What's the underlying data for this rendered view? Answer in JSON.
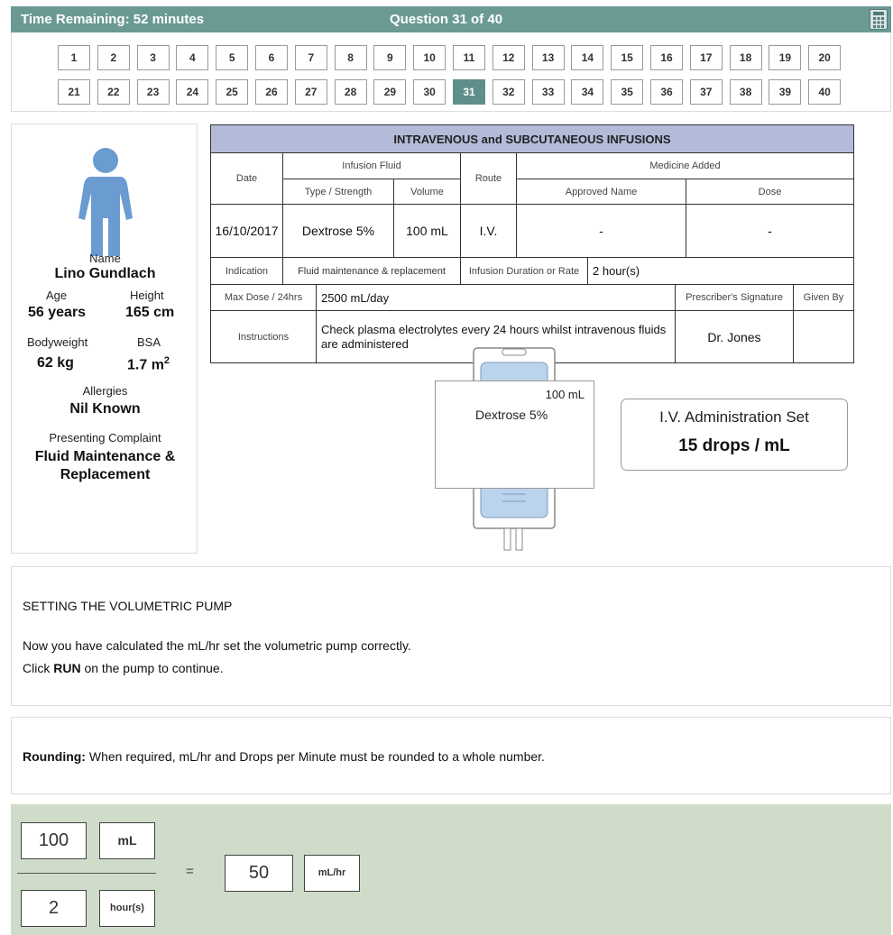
{
  "header": {
    "time_remaining": "Time Remaining: 52 minutes",
    "question_counter": "Question 31 of 40",
    "calculator_icon": "calculator-icon"
  },
  "question_nav": {
    "row1": [
      "1",
      "2",
      "3",
      "4",
      "5",
      "6",
      "7",
      "8",
      "9",
      "10",
      "11",
      "12",
      "13",
      "14",
      "15",
      "16",
      "17",
      "18",
      "19",
      "20"
    ],
    "row2": [
      "21",
      "22",
      "23",
      "24",
      "25",
      "26",
      "27",
      "28",
      "29",
      "30",
      "31",
      "32",
      "33",
      "34",
      "35",
      "36",
      "37",
      "38",
      "39",
      "40"
    ],
    "active": "31"
  },
  "patient": {
    "icon": "person-icon",
    "name_label": "Name",
    "name": "Lino Gundlach",
    "age_label": "Age",
    "age": "56 years",
    "height_label": "Height",
    "height": "165 cm",
    "weight_label": "Bodyweight",
    "weight": "62 kg",
    "bsa_label": "BSA",
    "bsa": "1.7 m",
    "bsa_sup": "2",
    "allergies_label": "Allergies",
    "allergies": "Nil Known",
    "complaint_label": "Presenting Complaint",
    "complaint_line1": "Fluid Maintenance &",
    "complaint_line2": "Replacement"
  },
  "chart": {
    "title": "INTRAVENOUS and SUBCUTANEOUS INFUSIONS",
    "date_h": "Date",
    "fluid_h": "Infusion Fluid",
    "type_h": "Type / Strength",
    "volume_h": "Volume",
    "route_h": "Route",
    "medicine_h": "Medicine Added",
    "approved_h": "Approved Name",
    "dose_h": "Dose",
    "date": "16/10/2017",
    "type": "Dextrose 5%",
    "volume": "100 mL",
    "route": "I.V.",
    "approved": "-",
    "dose": "-",
    "indication_h": "Indication",
    "indication": "Fluid maintenance & replacement",
    "duration_h": "Infusion Duration or Rate",
    "duration": "2 hour(s)",
    "maxdose_h": "Max Dose / 24hrs",
    "maxdose": "2500 mL/day",
    "prescriber_h": "Prescriber's Signature",
    "givenby_h": "Given By",
    "instructions_h": "Instructions",
    "instructions": "Check plasma electrolytes every 24 hours whilst intravenous fluids are administered",
    "prescriber": "Dr. Jones"
  },
  "bag": {
    "volume": "100 mL",
    "fluid": "Dextrose 5%"
  },
  "iv_set": {
    "title": "I.V. Administration Set",
    "rate": "15 drops / mL"
  },
  "instructions": {
    "heading": "SETTING THE VOLUMETRIC PUMP",
    "line1": "Now you have calculated the mL/hr set the volumetric pump correctly.",
    "line2_pre": "Click ",
    "line2_bold": "RUN",
    "line2_post": " on the pump to continue."
  },
  "rounding": {
    "bold": "Rounding:",
    "text": " When required, mL/hr and Drops per Minute must be rounded to a whole number."
  },
  "calculation": {
    "numerator": "100",
    "numerator_unit": "mL",
    "denominator": "2",
    "denominator_unit": "hour(s)",
    "equals": "=",
    "result": "50",
    "result_unit": "mL/hr"
  }
}
